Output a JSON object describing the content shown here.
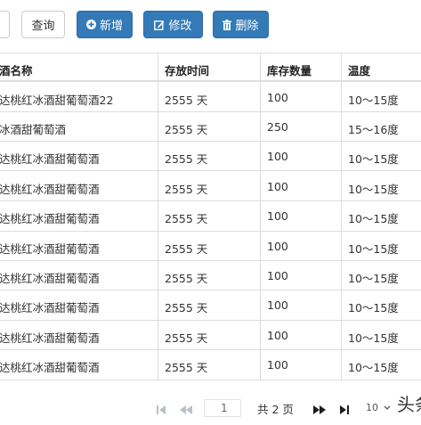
{
  "toolbar": {
    "query_label": "查询",
    "add_label": "新增",
    "edit_label": "修改",
    "delete_label": "删除"
  },
  "table": {
    "columns": [
      "酒名称",
      "存放时间",
      "库存数量",
      "温度"
    ],
    "rows": [
      [
        "达桃红冰酒甜葡萄酒22",
        "2555 天",
        "100",
        "10～15度"
      ],
      [
        "冰酒甜葡萄酒",
        "2555 天",
        "250",
        "15～16度"
      ],
      [
        "达桃红冰酒甜葡萄酒",
        "2555 天",
        "100",
        "10～15度"
      ],
      [
        "达桃红冰酒甜葡萄酒",
        "2555 天",
        "100",
        "10～15度"
      ],
      [
        "达桃红冰酒甜葡萄酒",
        "2555 天",
        "100",
        "10～15度"
      ],
      [
        "达桃红冰酒甜葡萄酒",
        "2555 天",
        "100",
        "10～15度"
      ],
      [
        "达桃红冰酒甜葡萄酒",
        "2555 天",
        "100",
        "10～15度"
      ],
      [
        "达桃红冰酒甜葡萄酒",
        "2555 天",
        "100",
        "10～15度"
      ],
      [
        "达桃红冰酒甜葡萄酒",
        "2555 天",
        "100",
        "10～15度"
      ],
      [
        "达桃红冰酒甜葡萄酒",
        "2555 天",
        "100",
        "10～15度"
      ]
    ]
  },
  "pager": {
    "current_page": "1",
    "total_label": "共 2 页",
    "page_size": "10"
  },
  "watermark": "头条",
  "colors": {
    "primary": "#337ab7",
    "border": "#dddddd",
    "disabled": "#b8c0c8"
  },
  "icons": {
    "add": "plus-icon",
    "edit": "edit-icon",
    "delete": "trash-icon",
    "first": "first-page-icon",
    "prev": "prev-page-icon",
    "next": "next-page-icon",
    "last": "last-page-icon",
    "dropdown": "chevron-down-icon"
  }
}
